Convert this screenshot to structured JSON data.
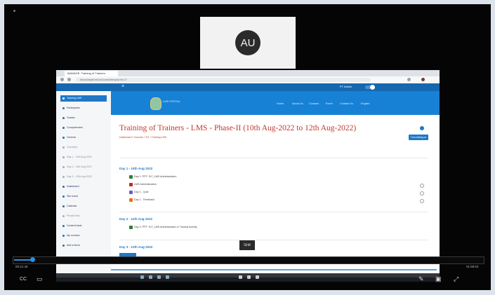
{
  "participant": {
    "initials": "AU"
  },
  "browser": {
    "tab_title": "MANAGE: Training of Trainers",
    "url": "lms.example.edu.in/course/view.php?id=17"
  },
  "topbar": {
    "user": "PT Admin"
  },
  "sidebar": {
    "items": [
      {
        "label": "Training LMS",
        "kind": "active"
      },
      {
        "label": "Participants",
        "kind": "main"
      },
      {
        "label": "Grades",
        "kind": "main"
      },
      {
        "label": "Competencies",
        "kind": "main"
      },
      {
        "label": "General",
        "kind": "main"
      },
      {
        "label": "Overview",
        "kind": "sub"
      },
      {
        "label": "Day 1 - 10th Aug 2022",
        "kind": "sub"
      },
      {
        "label": "Day 2 - 11th Aug 2022",
        "kind": "sub"
      },
      {
        "label": "Day 3 - 12th Aug 2022",
        "kind": "sub"
      },
      {
        "label": "Dashboard",
        "kind": "main"
      },
      {
        "label": "Site home",
        "kind": "main"
      },
      {
        "label": "Calendar",
        "kind": "main"
      },
      {
        "label": "Private files",
        "kind": "sub"
      },
      {
        "label": "Content bank",
        "kind": "main"
      },
      {
        "label": "My courses",
        "kind": "main"
      },
      {
        "label": "Add a block",
        "kind": "main"
      }
    ]
  },
  "header": {
    "logo_text": "LMS PORTAL",
    "nav": [
      "Home",
      "About Us",
      "Courses",
      "Event",
      "Contact Us",
      "English"
    ]
  },
  "course": {
    "title": "Training of Trainers - LMS - Phase-II (10th Aug-2022 to 12th Aug-2022)",
    "breadcrumb": "Dashboard / Courses / ToT / Training LMS",
    "side_button": "Turn editing on",
    "sections": [
      {
        "title": "Day 1 - 10th Aug 2022",
        "activities": [
          {
            "label": "Day 1: PPT: ToT_LMS Administration",
            "icon_color": "#2e7d32"
          },
          {
            "label": "LMS Administration",
            "icon_color": "#c62828"
          },
          {
            "label": "Day 1 - Quiz",
            "icon_color": "#6a5acd"
          },
          {
            "label": "Day 1 - Feedback",
            "icon_color": "#ef6c00"
          }
        ]
      },
      {
        "title": "Day 2 - 11th Aug 2022",
        "activities": [
          {
            "label": "Day 2: PPT: ToT_LMS Administration & Tutorial Activity",
            "icon_color": "#2e7d32"
          }
        ]
      },
      {
        "title": "Day 3 - 12th Aug 2022",
        "activities": []
      }
    ]
  },
  "player": {
    "tooltip": "Grid",
    "time_current": "00:21:45",
    "time_total": "01:58:03",
    "progress": 0.04
  },
  "controls": [
    {
      "name": "captions-icon",
      "glyph": "CC"
    },
    {
      "name": "chat-icon",
      "glyph": "▭"
    },
    {
      "name": "pen-icon",
      "glyph": "✎"
    },
    {
      "name": "picture-in-picture-icon",
      "glyph": "▣"
    },
    {
      "name": "fullscreen-icon",
      "glyph": "⤢"
    }
  ],
  "colors": {
    "primary": "#1f78c8",
    "title_red": "#c0392b",
    "seek_blue": "#2b8fe0",
    "background": "#050505"
  }
}
